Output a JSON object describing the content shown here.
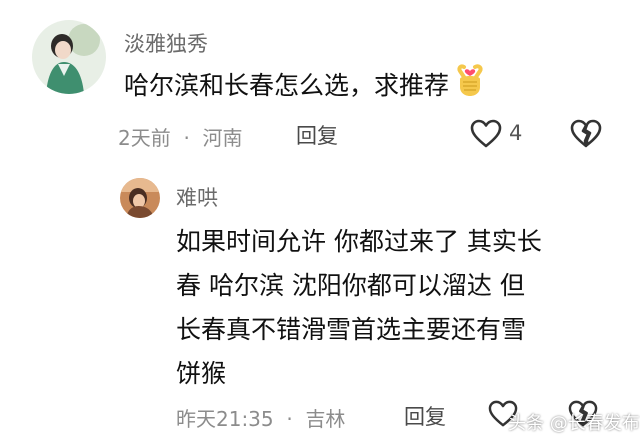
{
  "comment": {
    "author": "淡雅独秀",
    "text": "哈尔滨和长春怎么选，求推荐",
    "emoji": "🫰",
    "time": "2天前",
    "location": "河南",
    "reply_label": "回复",
    "like_count": "4"
  },
  "reply": {
    "author": "难哄",
    "lines": [
      "如果时间允许 你都过来了 其实长",
      "春 哈尔滨 沈阳你都可以溜达 但",
      "长春真不错滑雪首选主要还有雪",
      "饼猴"
    ],
    "time": "昨天21:35",
    "location": "吉林",
    "reply_label": "回复"
  },
  "watermark": "头条 @长春发布",
  "icons": {
    "like": "heart-outline-icon",
    "dislike": "broken-heart-icon",
    "emoji": "finger-heart-emoji"
  },
  "colors": {
    "name": "#6b6b6b",
    "meta": "#8c8c8c",
    "emoji": "#f5c84c",
    "emoji_heart": "#ff4d6d"
  }
}
